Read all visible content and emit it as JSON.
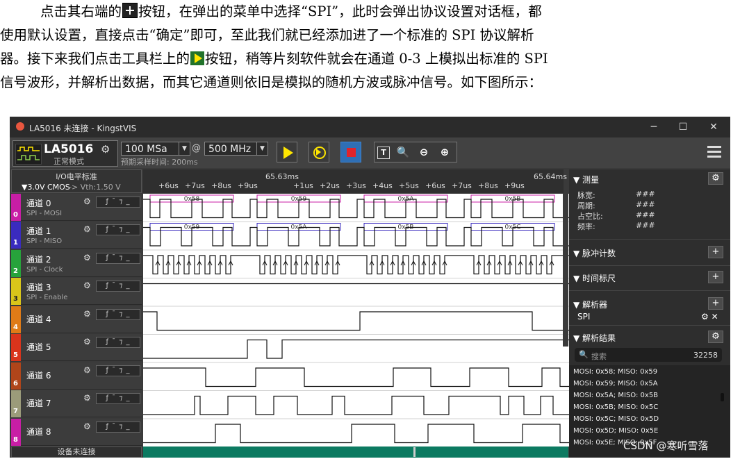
{
  "doc": {
    "lines": [
      {
        "a": "点击其右端的",
        "b": "按钮，在弹出的菜单中选择“SPI”，此时会弹出协议设置对话框，都"
      },
      {
        "a": "使用默认设置，直接点击“确定”即可，至此我们就已经添加进了一个标准的 SPI 协议解析"
      },
      {
        "a": "器。接下来我们点击工具栏上的",
        "b": "按钮，稍等片刻软件就会在通道 0-3 上模拟出标准的 SPI"
      },
      {
        "a": "信号波形，并解析出数据，而其它通道则依旧是模拟的随机方波或脉冲信号。如下图所示："
      }
    ],
    "icons": [
      "plus-button-icon",
      "play-button-icon"
    ]
  },
  "window": {
    "title": "LA5016 未连接 - KingstVIS",
    "controls": {
      "minimize": "─",
      "maximize": "☐",
      "close": "✕"
    }
  },
  "toolbar": {
    "device_name": "LA5016",
    "device_mode": "正常模式",
    "gear": "⚙",
    "sample_count": "100 MSa",
    "at_sign": "@",
    "sample_rate": "500 MHz",
    "dropdown_arrow": "▼",
    "pre_sample_time": "预期采样时间: 200ms",
    "zoom_buttons": [
      "T",
      "🔍",
      "⊖",
      "⊕"
    ]
  },
  "io": {
    "title": "I/O电平标准",
    "voltage": "▼3.0V CMOS",
    "vth": "-> Vth:1.50 V"
  },
  "ruler": {
    "majors": [
      {
        "label": "65.63ms"
      },
      {
        "label": "65.64ms"
      }
    ],
    "left_ticks": [
      "+6us",
      "+7us",
      "+8us",
      "+9us"
    ],
    "right_ticks": [
      "+1us",
      "+2us",
      "+3us",
      "+4us",
      "+5us",
      "+6us",
      "+7us",
      "+8us",
      "+9us"
    ]
  },
  "channels": [
    {
      "num": "0",
      "name": "通道 0",
      "sub": "SPI - MOSI",
      "color": "#c81ea5"
    },
    {
      "num": "1",
      "name": "通道 1",
      "sub": "SPI - MISO",
      "color": "#3a2bbf"
    },
    {
      "num": "2",
      "name": "通道 2",
      "sub": "SPI - Clock",
      "color": "#27a33b"
    },
    {
      "num": "3",
      "name": "通道 3",
      "sub": "SPI - Enable",
      "color": "#d9c51a"
    },
    {
      "num": "4",
      "name": "通道 4",
      "sub": "",
      "color": "#e07b17"
    },
    {
      "num": "5",
      "name": "通道 5",
      "sub": "",
      "color": "#d9341c"
    },
    {
      "num": "6",
      "name": "通道 6",
      "sub": "",
      "color": "#b0451a"
    },
    {
      "num": "7",
      "name": "通道 7",
      "sub": "",
      "color": "#9b9b7a"
    },
    {
      "num": "8",
      "name": "通道 8",
      "sub": "",
      "color": "#c81ea5"
    }
  ],
  "channel_trigger_glyphs": "ƒ ¯ ⁊ _",
  "decode": {
    "mosi": [
      "0x58",
      "0x59",
      "0x5A",
      "0x5B"
    ],
    "miso": [
      "0x59",
      "0x5A",
      "0x5B",
      "0x5C"
    ],
    "mosi_color": "#c81ea5",
    "miso_color": "#3a2bbf"
  },
  "footer": {
    "status": "设备未连接"
  },
  "panel": {
    "measure": {
      "title": "▼ 测量",
      "rows": [
        {
          "label": "脉宽:",
          "value": "###"
        },
        {
          "label": "周期:",
          "value": "###"
        },
        {
          "label": "占空比:",
          "value": "###"
        },
        {
          "label": "频率:",
          "value": "###"
        }
      ]
    },
    "pulse_count": {
      "title": "▼ 脉冲计数",
      "btn": "+"
    },
    "time_marker": {
      "title": "▼ 时间标尺",
      "btn": "+"
    },
    "analyzer": {
      "title": "▼ 解析器",
      "btn": "+",
      "item": "SPI",
      "item_icons": "⚙ ✕"
    },
    "results": {
      "title": "▼ 解析结果",
      "search_placeholder": "搜索",
      "count": "32258",
      "rows": [
        "MOSI: 0x58;  MISO: 0x59",
        "MOSI: 0x59;  MISO: 0x5A",
        "MOSI: 0x5A;  MISO: 0x5B",
        "MOSI: 0x5B;  MISO: 0x5C",
        "MOSI: 0x5C;  MISO: 0x5D",
        "MOSI: 0x5D;  MISO: 0x5E",
        "MOSI: 0x5E;  MISO: 0x5F"
      ]
    }
  },
  "watermark": "CSDN @寒听雪落",
  "colors": {
    "accent_blue": "#2f6fb5",
    "stop_red": "#e0242b",
    "play_yellow": "#ffe600",
    "footer_green": "#0c7a61"
  }
}
